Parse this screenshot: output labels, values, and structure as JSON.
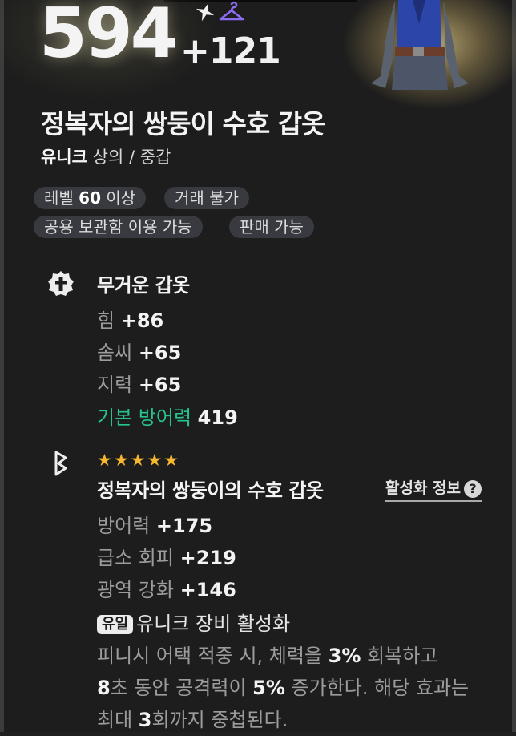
{
  "header": {
    "score": "594",
    "bonus": "+121"
  },
  "item": {
    "name": "정복자의 쌍둥이 수호 갑옷",
    "rarity": "유니크",
    "type": "상의 / 중갑"
  },
  "tags": {
    "level_prefix": "레벨",
    "level_value": "60",
    "level_suffix": "이상",
    "trade": "거래 불가",
    "storage": "공용 보관함 이용 가능",
    "sell": "판매 가능"
  },
  "base_section": {
    "title": "무거운 갑옷",
    "stats": [
      {
        "label": "힘",
        "value": "+86"
      },
      {
        "label": "솜씨",
        "value": "+65"
      },
      {
        "label": "지력",
        "value": "+65"
      },
      {
        "label": "기본 방어력",
        "value": "419"
      }
    ]
  },
  "set_section": {
    "stars": "★★★★★",
    "title": "정복자의 쌍둥이의 수호 갑옷",
    "activation_link": "활성화 정보",
    "stats": [
      {
        "label": "방어력",
        "value": "+175"
      },
      {
        "label": "급소 회피",
        "value": "+219"
      },
      {
        "label": "광역 강화",
        "value": "+146"
      }
    ],
    "unique_badge": "유일",
    "unique_text": "유니크 장비 활성화",
    "desc": {
      "p1": "피니시 어택 적중 시, 체력을 ",
      "n1": "3%",
      "p2": " 회복하고",
      "n2": "8",
      "p3": "초 동안 공격력이 ",
      "n3": "5%",
      "p4": " 증가한다. 해당 효과는",
      "p5": "최대 ",
      "n4": "3",
      "p6": "회까지 중첩된다."
    }
  },
  "colors": {
    "accent_green": "#27c38f",
    "star_gold": "#f6b731",
    "hanger_purple": "#8c6cf0"
  },
  "icons": [
    "sparkle-icon",
    "hanger-icon",
    "armor-icon",
    "medal-icon",
    "rune-icon",
    "help-icon"
  ]
}
